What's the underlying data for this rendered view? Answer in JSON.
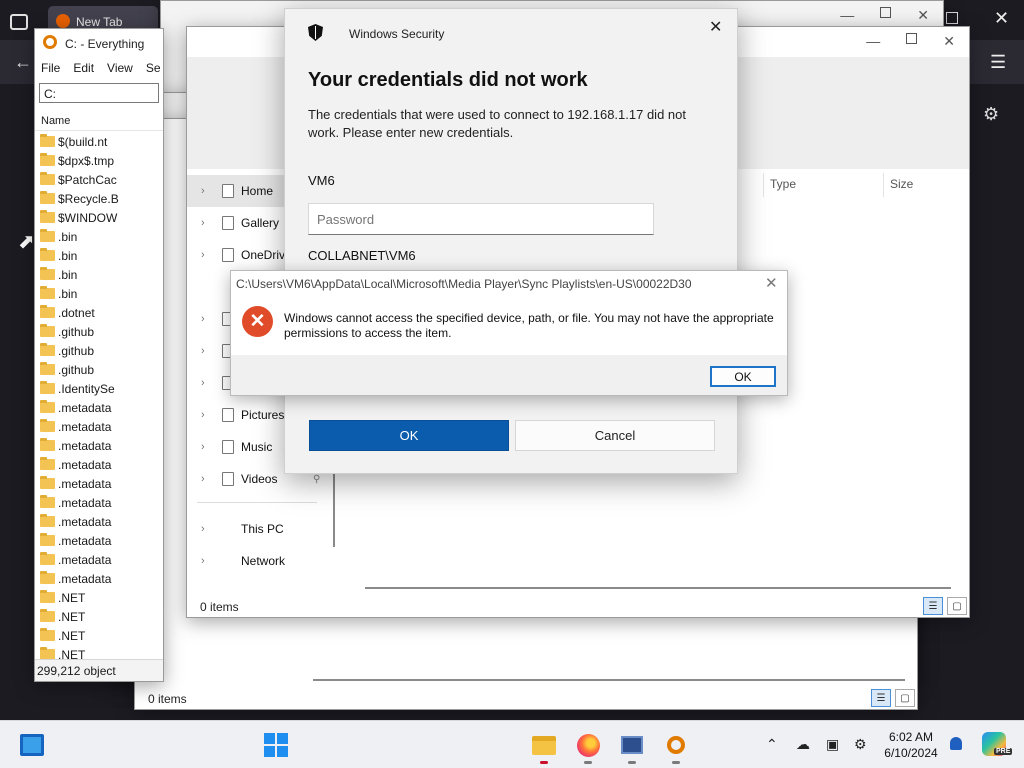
{
  "browser": {
    "tab_title": "New Tab",
    "accent": "#1c1b22"
  },
  "everything": {
    "title": "C: - Everything",
    "menu": [
      "File",
      "Edit",
      "View",
      "Se"
    ],
    "search_value": "C:",
    "column_name": "Name",
    "items": [
      "$(build.nt",
      "$dpx$.tmp",
      "$PatchCac",
      "$Recycle.B",
      "$WINDOW",
      ".bin",
      ".bin",
      ".bin",
      ".bin",
      ".dotnet",
      ".github",
      ".github",
      ".github",
      ".IdentitySe",
      ".metadata",
      ".metadata",
      ".metadata",
      ".metadata",
      ".metadata",
      ".metadata",
      ".metadata",
      ".metadata",
      ".metadata",
      ".metadata",
      ".NET",
      ".NET",
      ".NET",
      ".NET"
    ],
    "status": "299,212 object"
  },
  "explorer_back": {
    "w1_status": "0 i",
    "w2_status": "0 i",
    "w3_status": "0 items"
  },
  "explorer": {
    "columns": [
      "Type",
      "Size"
    ],
    "nav": [
      {
        "label": "Home",
        "selected": true
      },
      {
        "label": "Gallery"
      },
      {
        "label": "OneDriv"
      },
      {
        "label": ""
      },
      {
        "label": ""
      },
      {
        "label": ""
      },
      {
        "label": "Pictures"
      },
      {
        "label": "Music"
      },
      {
        "label": "Videos"
      },
      {
        "label": "This PC"
      },
      {
        "label": "Network"
      }
    ],
    "status": "0 items"
  },
  "security_dialog": {
    "app_name": "Windows Security",
    "heading": "Your credentials did not work",
    "message": "The credentials that were used to connect to 192.168.1.17 did not work. Please enter new credentials.",
    "username": "VM6",
    "password_placeholder": "Password",
    "domain_user": "COLLABNET\\VM6",
    "ok_label": "OK",
    "cancel_label": "Cancel",
    "accent": "#0b5cad"
  },
  "error_dialog": {
    "title": "C:\\Users\\VM6\\AppData\\Local\\Microsoft\\Media Player\\Sync Playlists\\en-US\\00022D30",
    "message": "Windows cannot access the specified device, path, or file. You may not have the appropriate permissions to access the item.",
    "ok_label": "OK",
    "icon": "error-icon",
    "icon_color": "#e04b2a"
  },
  "taskbar": {
    "time": "6:02 AM",
    "date": "6/10/2024",
    "copilot_badge": "PRE",
    "apps": [
      "file-explorer",
      "firefox",
      "remote-desktop",
      "everything"
    ]
  }
}
